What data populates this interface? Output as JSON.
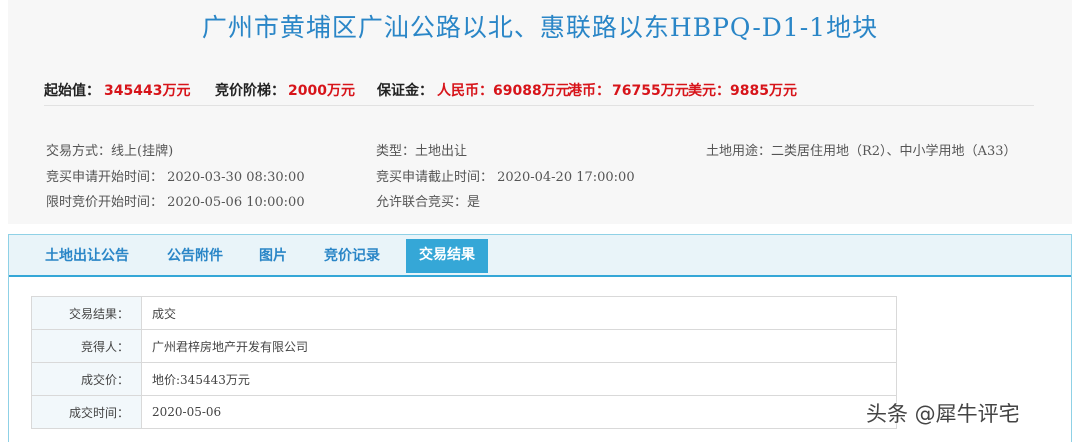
{
  "title": "广州市黄埔区广汕公路以北、惠联路以东HBPQ-D1-1地块",
  "price": {
    "start_label": "起始值：",
    "start_value": "345443万元",
    "step_label": "竞价阶梯：",
    "step_value": "2000万元",
    "deposit_label": "保证金：",
    "rmb_label": "人民币：",
    "rmb_value": "69088万元",
    "hkd_label": "港币：",
    "hkd_value": "76755万元",
    "usd_label": "美元：",
    "usd_value": "9885万元"
  },
  "info": {
    "trade_mode": "交易方式：线上(挂牌)",
    "type": "类型：土地出让",
    "land_use": "土地用途：二类居住用地（R2）、中小学用地（A33）",
    "apply_start": "竞买申请开始时间：  2020-03-30 08:30:00",
    "apply_end": "竞买申请截止时间：  2020-04-20 17:00:00",
    "bid_start": "限时竞价开始时间：  2020-05-06 10:00:00",
    "joint_bid": "允许联合竞买：是"
  },
  "tabs": [
    {
      "label": "土地出让公告"
    },
    {
      "label": "公告附件"
    },
    {
      "label": "图片"
    },
    {
      "label": "竞价记录"
    },
    {
      "label": "交易结果"
    }
  ],
  "result": {
    "rows": [
      {
        "key": "交易结果：",
        "value": "成交"
      },
      {
        "key": "竞得人：",
        "value": "广州君梓房地产开发有限公司"
      },
      {
        "key": "成交价：",
        "value": "地价:345443万元"
      },
      {
        "key": "成交时间：",
        "value": "2020-05-06"
      }
    ]
  },
  "watermark": "头条 @犀牛评宅"
}
